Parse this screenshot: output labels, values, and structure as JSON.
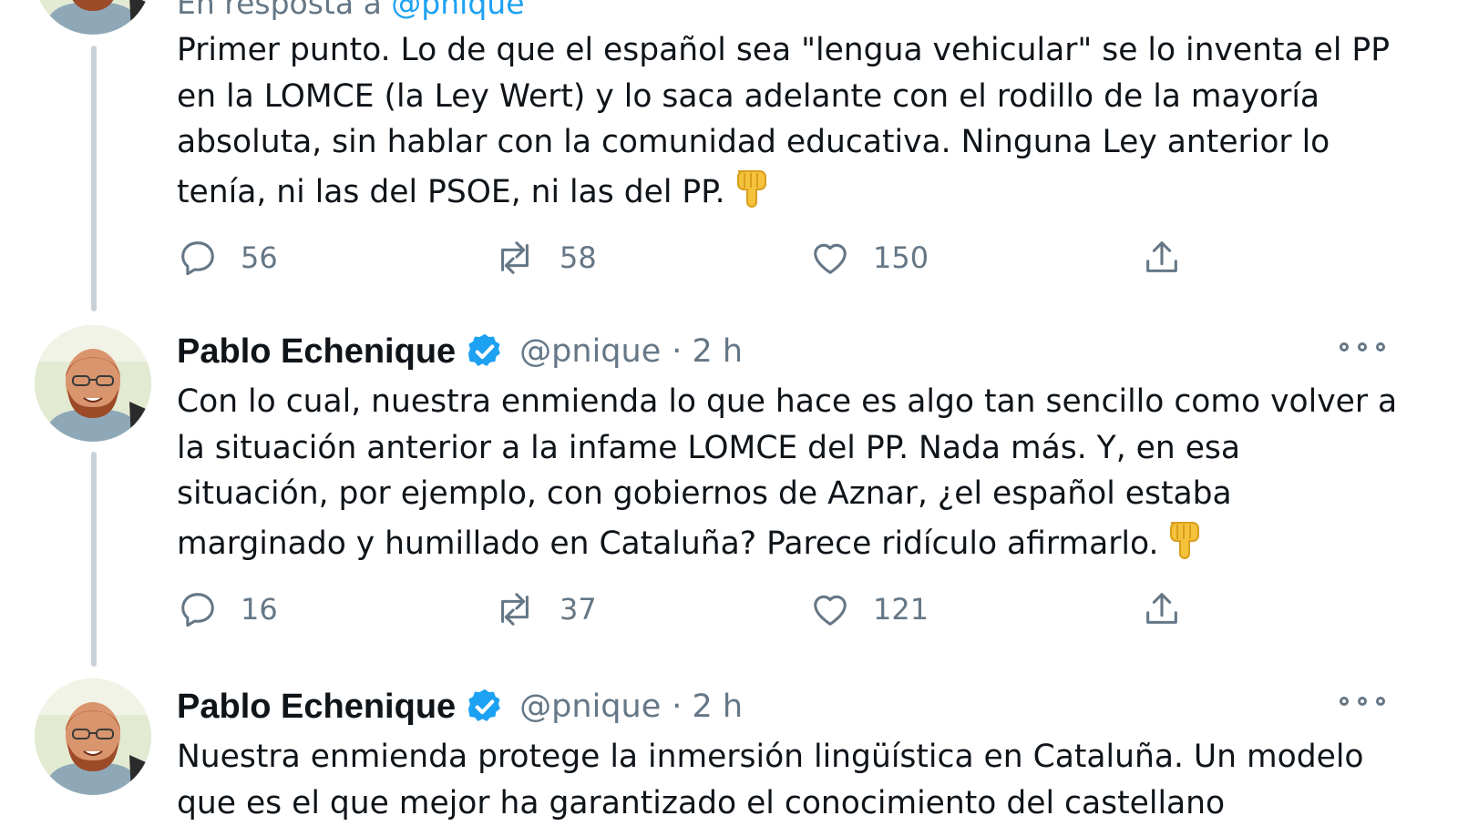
{
  "colors": {
    "accent": "#1da1f2",
    "text": "#0f1419",
    "muted": "#657786",
    "thread_line": "#c9d1d8"
  },
  "icons": {
    "reply": "reply-icon",
    "retweet": "retweet-icon",
    "like": "heart-icon",
    "share": "share-icon",
    "emoji": "backhand-index-pointing-down"
  },
  "tweets": [
    {
      "reply_prefix": "En resposta a",
      "reply_handle": "@pnique",
      "text": "Primer punto. Lo de que el español sea \"lengua vehicular\" se lo inventa el PP en la LOMCE (la Ley Wert) y lo saca adelante con el rodillo de la mayoría absoluta, sin hablar con la comunidad educativa. Ninguna Ley anterior lo tenía, ni las del PSOE, ni las del PP.",
      "replies": "56",
      "retweets": "58",
      "likes": "150"
    },
    {
      "name": "Pablo Echenique",
      "handle": "@pnique",
      "time": "· 2 h",
      "text": "Con lo cual, nuestra enmienda lo que hace es algo tan sencillo como volver a la situación anterior a la infame LOMCE del PP. Nada más. Y, en esa situación, por ejemplo, con gobiernos de Aznar, ¿el español estaba marginado y humillado en Cataluña? Parece ridículo afirmarlo.",
      "replies": "16",
      "retweets": "37",
      "likes": "121"
    },
    {
      "name": "Pablo Echenique",
      "handle": "@pnique",
      "time": "· 2 h",
      "text": "Nuestra enmienda protege la inmersión lingüística en Cataluña. Un modelo que es el que mejor ha garantizado el conocimiento del castellano"
    }
  ]
}
